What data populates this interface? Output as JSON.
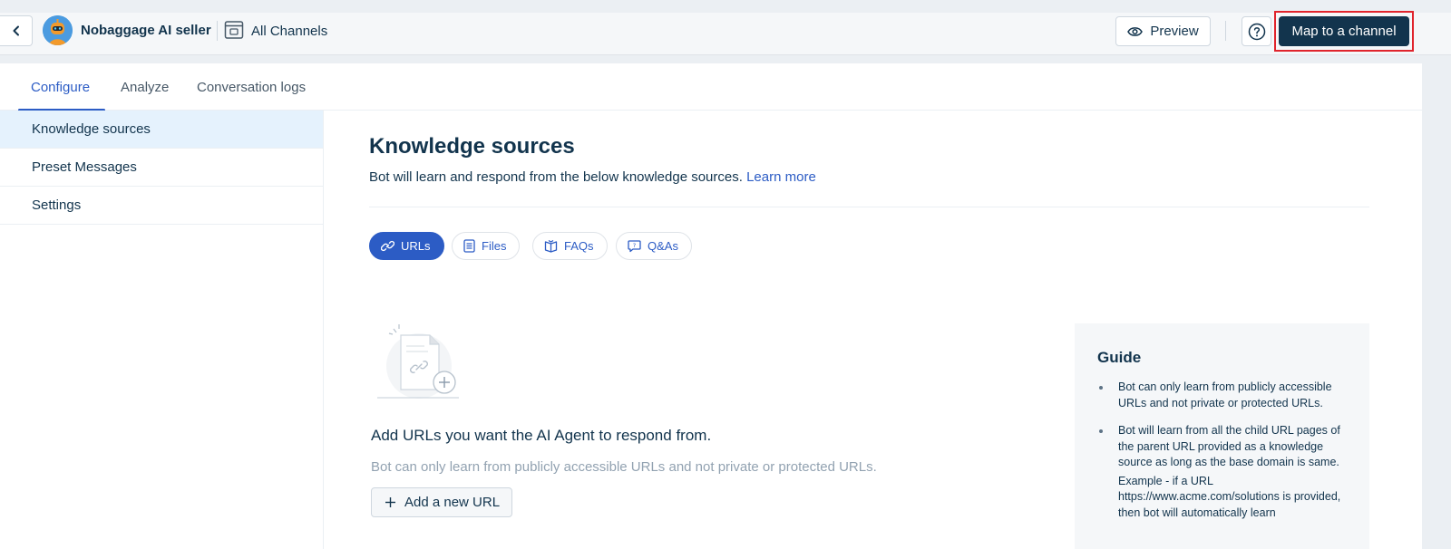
{
  "header": {
    "bot_name": "Nobaggage AI seller",
    "channels_label": "All Channels",
    "preview_label": "Preview",
    "map_label": "Map to a channel"
  },
  "tabs": [
    {
      "label": "Configure",
      "active": true
    },
    {
      "label": "Analyze",
      "active": false
    },
    {
      "label": "Conversation logs",
      "active": false
    }
  ],
  "sidebar": {
    "items": [
      {
        "label": "Knowledge sources",
        "active": true
      },
      {
        "label": "Preset Messages",
        "active": false
      },
      {
        "label": "Settings",
        "active": false
      }
    ]
  },
  "main": {
    "title": "Knowledge sources",
    "subtitle": "Bot will learn and respond from the below knowledge sources.",
    "learn_more": "Learn more",
    "source_tabs": [
      {
        "label": "URLs",
        "icon": "link-icon",
        "active": true
      },
      {
        "label": "Files",
        "icon": "file-icon",
        "active": false
      },
      {
        "label": "FAQs",
        "icon": "book-icon",
        "active": false
      },
      {
        "label": "Q&As",
        "icon": "chat-question-icon",
        "active": false
      }
    ],
    "empty_title": "Add URLs you want the AI Agent to respond from.",
    "empty_subtitle": "Bot can only learn from publicly accessible URLs and not private or protected URLs.",
    "add_button": "Add a new URL"
  },
  "guide": {
    "title": "Guide",
    "items": [
      "Bot can only learn from publicly accessible URLs and not private or protected URLs.",
      "Bot will learn from all the child URL pages of the parent URL provided as a knowledge source as long as the base domain is same."
    ],
    "example": "Example - if a URL https://www.acme.com/solutions is provided, then bot will automatically learn"
  },
  "colors": {
    "accent": "#2c5cc5",
    "primary_dark": "#12344d",
    "highlight_border": "#e0242c"
  }
}
